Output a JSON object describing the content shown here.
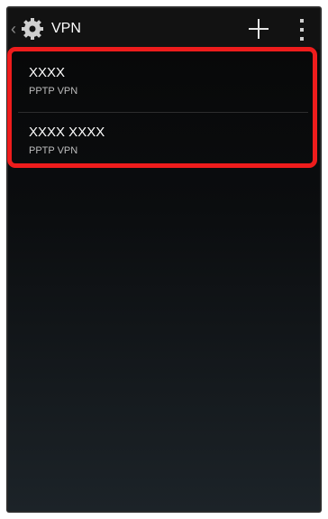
{
  "actionbar": {
    "title": "VPN",
    "up_icon": "chevron-left-icon",
    "settings_icon": "gear-icon",
    "add_icon": "plus-icon",
    "overflow_icon": "overflow-menu-icon"
  },
  "vpn_list": [
    {
      "name": "XXXX",
      "type": "PPTP VPN"
    },
    {
      "name": "XXXX XXXX",
      "type": "PPTP VPN"
    }
  ],
  "colors": {
    "highlight": "#ee1c1c",
    "actionbar_bg": "#121212",
    "text_primary": "#ffffff",
    "text_secondary": "#bdbdbd"
  }
}
